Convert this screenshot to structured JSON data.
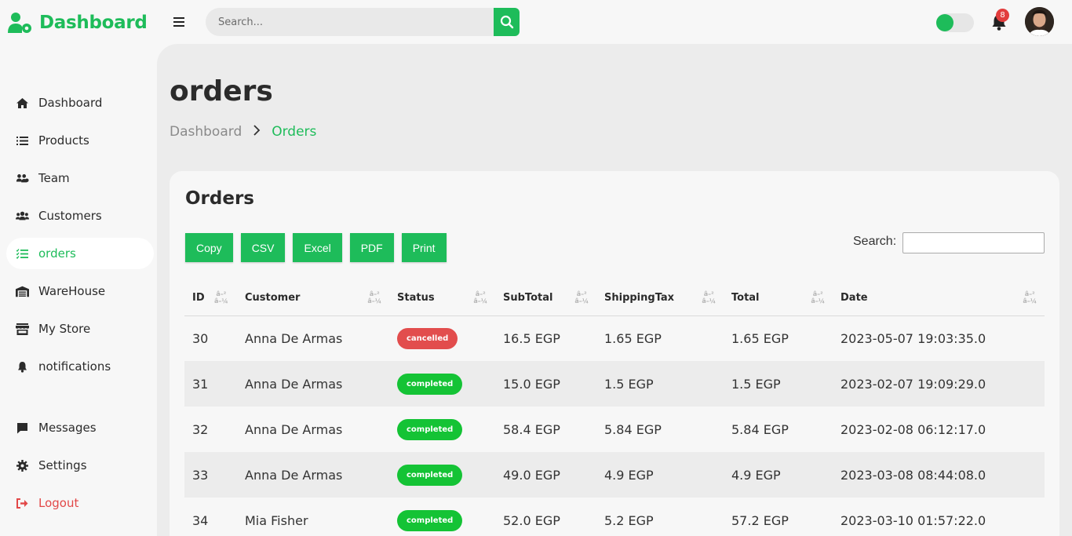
{
  "brand": {
    "title": "Dashboard"
  },
  "search": {
    "placeholder": "Search..."
  },
  "notifications": {
    "count": "8"
  },
  "sidebar": {
    "items": [
      {
        "label": "Dashboard",
        "icon": "home-icon"
      },
      {
        "label": "Products",
        "icon": "list-icon"
      },
      {
        "label": "Team",
        "icon": "team-icon"
      },
      {
        "label": "Customers",
        "icon": "users-icon"
      },
      {
        "label": "orders",
        "icon": "checklist-icon",
        "active": true
      },
      {
        "label": "WareHouse",
        "icon": "warehouse-icon"
      },
      {
        "label": "My Store",
        "icon": "store-icon"
      },
      {
        "label": "notifications",
        "icon": "bell-icon"
      },
      {
        "label": "Messages",
        "icon": "message-icon"
      },
      {
        "label": "Settings",
        "icon": "gear-icon"
      },
      {
        "label": "Logout",
        "icon": "logout-icon"
      }
    ]
  },
  "page": {
    "title": "orders",
    "breadcrumb": {
      "home": "Dashboard",
      "current": "Orders"
    }
  },
  "card": {
    "title": "Orders",
    "buttons": {
      "copy": "Copy",
      "csv": "CSV",
      "excel": "Excel",
      "pdf": "PDF",
      "print": "Print"
    },
    "search_label": "Search:"
  },
  "table": {
    "columns": [
      "ID",
      "Customer",
      "Status",
      "SubTotal",
      "ShippingTax",
      "Total",
      "Date"
    ],
    "rows": [
      {
        "id": "30",
        "customer": "Anna De Armas",
        "status": "cancelled",
        "subtotal": "16.5 EGP",
        "shipping": "1.65 EGP",
        "total": "1.65 EGP",
        "date": "2023-05-07 19:03:35.0"
      },
      {
        "id": "31",
        "customer": "Anna De Armas",
        "status": "completed",
        "subtotal": "15.0 EGP",
        "shipping": "1.5 EGP",
        "total": "1.5 EGP",
        "date": "2023-02-07 19:09:29.0"
      },
      {
        "id": "32",
        "customer": "Anna De Armas",
        "status": "completed",
        "subtotal": "58.4 EGP",
        "shipping": "5.84 EGP",
        "total": "5.84 EGP",
        "date": "2023-02-08 06:12:17.0"
      },
      {
        "id": "33",
        "customer": "Anna De Armas",
        "status": "completed",
        "subtotal": "49.0 EGP",
        "shipping": "4.9 EGP",
        "total": "4.9 EGP",
        "date": "2023-03-08 08:44:08.0"
      },
      {
        "id": "34",
        "customer": "Mia Fisher",
        "status": "completed",
        "subtotal": "52.0 EGP",
        "shipping": "5.2 EGP",
        "total": "57.2 EGP",
        "date": "2023-03-10 01:57:22.0"
      }
    ]
  },
  "colors": {
    "accent": "#1ebc5a",
    "cancelled": "#e24d4d",
    "completed": "#14c335",
    "logout": "#e24848"
  }
}
